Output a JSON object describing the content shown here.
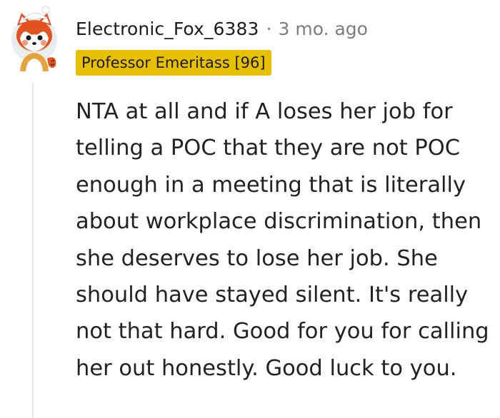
{
  "comment": {
    "username": "Electronic_Fox_6383",
    "separator": "·",
    "timestamp": "3 mo. ago",
    "flair": "Professor Emeritass [96]",
    "body": "NTA at all and if A loses her job for telling a POC that they are not POC enough in a meeting that is literally about workplace discrimination, then she deserves to lose her job. She should have stayed silent. It's really not that hard. Good for you for calling her out honestly. Good luck to you.",
    "avatar_icon": "red-panda-avatar-icon"
  },
  "colors": {
    "flair_background": "#e7c000",
    "username": "#1c1c1c",
    "meta": "#7c7c7c",
    "body": "#222222",
    "thread_line": "#e6e8eb"
  }
}
